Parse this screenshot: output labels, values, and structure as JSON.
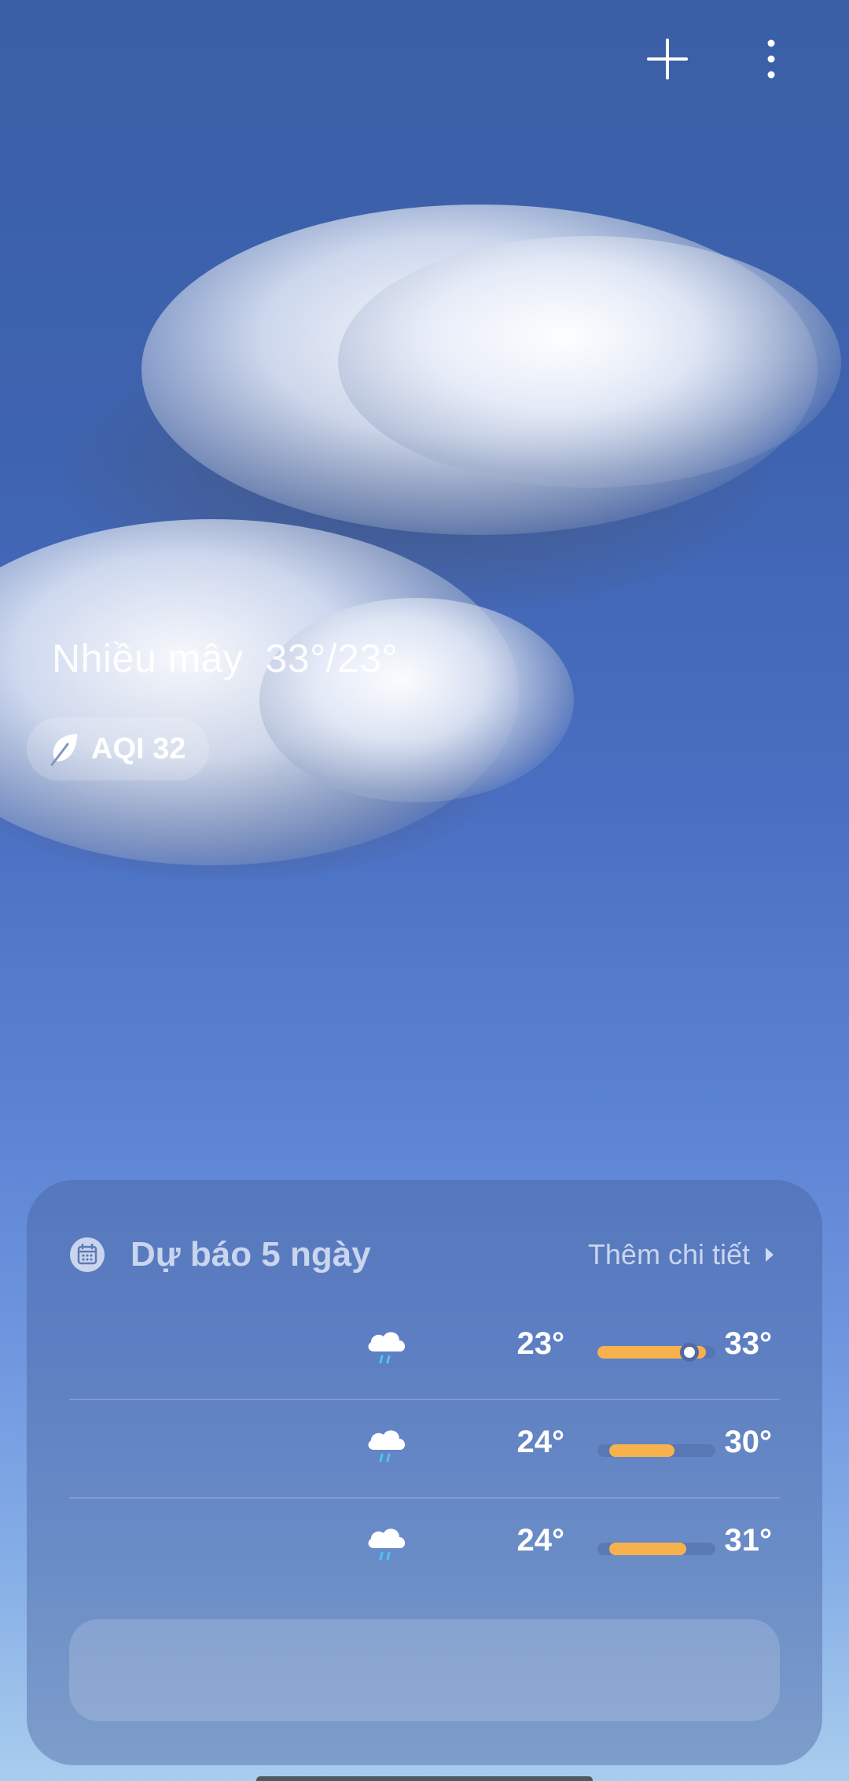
{
  "header": {
    "add_icon": "plus-icon",
    "menu_icon": "more-vertical-icon"
  },
  "current": {
    "condition": "Nhiều mây",
    "high_low": "33°/23°",
    "aqi_label": "AQI 32",
    "aqi_icon": "leaf-icon"
  },
  "forecast": {
    "title": "Dự báo 5 ngày",
    "more_label": "Thêm chi tiết",
    "calendar_icon": "calendar-icon",
    "days": [
      {
        "icon": "rain-cloud-icon",
        "min": "23°",
        "max": "33°",
        "range_start": 0.0,
        "range_end": 0.92,
        "current_marker": 0.78
      },
      {
        "icon": "rain-cloud-icon",
        "min": "24°",
        "max": "30°",
        "range_start": 0.1,
        "range_end": 0.65
      },
      {
        "icon": "rain-cloud-icon",
        "min": "24°",
        "max": "31°",
        "range_start": 0.1,
        "range_end": 0.75
      }
    ]
  },
  "colors": {
    "range_fill": "#f7b24e",
    "rain_drop": "#4fc3f7"
  }
}
